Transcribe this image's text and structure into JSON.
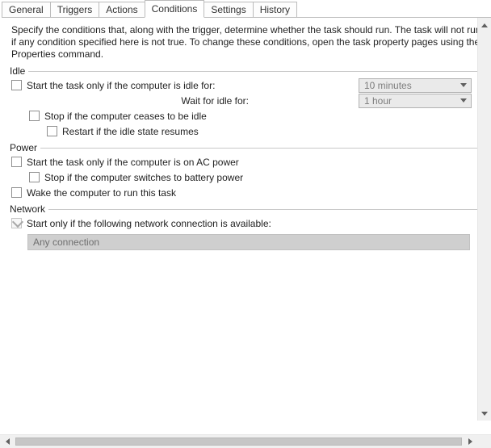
{
  "tabs": {
    "general": "General",
    "triggers": "Triggers",
    "actions": "Actions",
    "conditions": "Conditions",
    "settings": "Settings",
    "history": "History",
    "active": "conditions"
  },
  "description": {
    "line1": "Specify the conditions that, along with the trigger, determine whether the task should run.  The task will not run",
    "line2": "if any condition specified here is not true.  To change these conditions, open the task property pages using the",
    "line3": "Properties command."
  },
  "idle": {
    "header": "Idle",
    "start_only_idle": "Start the task only if the computer is idle for:",
    "wait_for_idle": "Wait for idle for:",
    "stop_ceases_idle": "Stop if the computer ceases to be idle",
    "restart_idle_resumes": "Restart if the idle state resumes",
    "duration_value": "10 minutes",
    "wait_value": "1 hour"
  },
  "power": {
    "header": "Power",
    "start_only_ac": "Start the task only if the computer is on AC power",
    "stop_on_battery": "Stop if the computer switches to battery power",
    "wake_to_run": "Wake the computer to run this task"
  },
  "network": {
    "header": "Network",
    "start_only_network": "Start only if the following network connection is available:",
    "connection_value": "Any connection"
  }
}
